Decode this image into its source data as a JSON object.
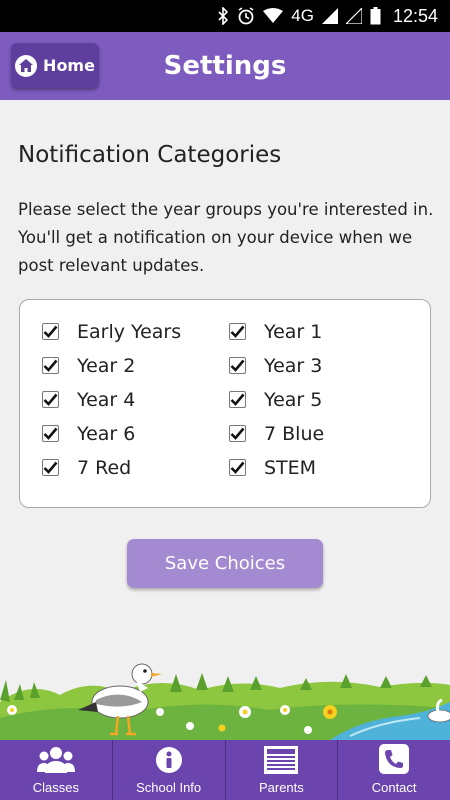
{
  "status_bar": {
    "network": "4G",
    "time": "12:54",
    "icons": [
      "bluetooth-icon",
      "alarm-icon",
      "wifi-icon",
      "signal-icon",
      "battery-icon"
    ]
  },
  "header": {
    "home_label": "Home",
    "title": "Settings"
  },
  "notifications": {
    "title": "Notification Categories",
    "description": "Please select the year groups you're interested in. You'll get a notification on your device when we post relevant updates.",
    "categories": [
      {
        "label": "Early Years",
        "checked": true
      },
      {
        "label": "Year 1",
        "checked": true
      },
      {
        "label": "Year 2",
        "checked": true
      },
      {
        "label": "Year 3",
        "checked": true
      },
      {
        "label": "Year 4",
        "checked": true
      },
      {
        "label": "Year 5",
        "checked": true
      },
      {
        "label": "Year 6",
        "checked": true
      },
      {
        "label": "7 Blue",
        "checked": true
      },
      {
        "label": "7 Red",
        "checked": true
      },
      {
        "label": "STEM",
        "checked": true
      }
    ],
    "save_label": "Save Choices"
  },
  "bottom_nav": {
    "items": [
      {
        "label": "Classes",
        "icon": "people-icon"
      },
      {
        "label": "School Info",
        "icon": "info-icon"
      },
      {
        "label": "Parents",
        "icon": "newsletter-icon"
      },
      {
        "label": "Contact",
        "icon": "phone-icon"
      }
    ]
  },
  "colors": {
    "header": "#7d5bbf",
    "home_button": "#5e3f9e",
    "save_button": "#a48ad1",
    "nav": "#6b45ad"
  }
}
